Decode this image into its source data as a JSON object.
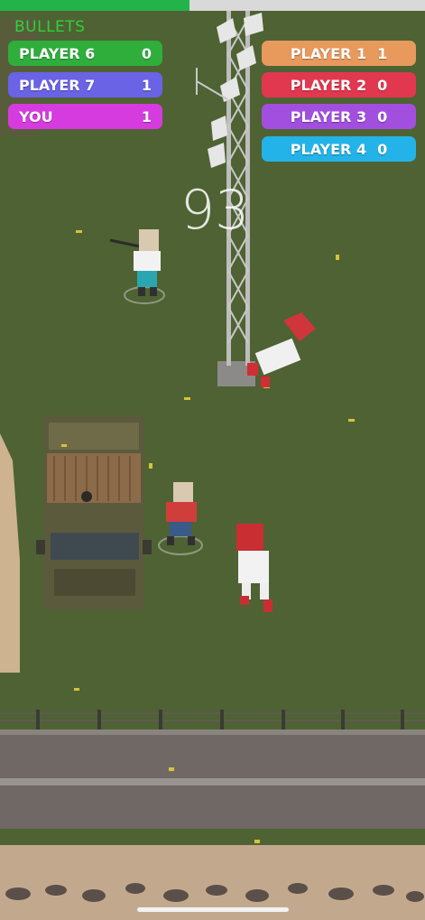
{
  "hud": {
    "bullets_label": "BULLETS",
    "bullets_fraction": 0.445,
    "timer": "93"
  },
  "scoreboard": {
    "left": [
      {
        "name": "PLAYER 6",
        "score": "0",
        "color": "#2fae3c"
      },
      {
        "name": "PLAYER 7",
        "score": "1",
        "color": "#6a63e6"
      },
      {
        "name": "YOU",
        "score": "1",
        "color": "#d63be0"
      }
    ],
    "right": [
      {
        "name": "PLAYER 1",
        "score": "1",
        "color": "#e89a5c"
      },
      {
        "name": "PLAYER 2",
        "score": "0",
        "color": "#e2384f"
      },
      {
        "name": "PLAYER 3",
        "score": "0",
        "color": "#a24fe0"
      },
      {
        "name": "PLAYER 4",
        "score": "0",
        "color": "#24b3e8"
      }
    ]
  },
  "colors": {
    "grass": "#4f6233",
    "road": "#6f6864",
    "sand": "#c2a98e"
  }
}
